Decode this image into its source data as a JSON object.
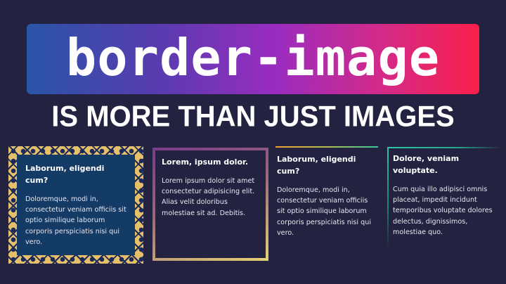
{
  "title": "border-image",
  "subtitle": "IS MORE THAN JUST IMAGES",
  "cards": [
    {
      "heading": "Laborum, eligendi cum?",
      "body": "Doloremque, modi in, consectetur veniam officiis sit optio similique laborum corporis perspiciatis nisi qui vero."
    },
    {
      "heading": "Lorem, ipsum dolor.",
      "body": "Lorem ipsum dolor sit amet consectetur adipisicing elit. Alias velit doloribus molestiae sit ad. Debitis."
    },
    {
      "heading": "Laborum, eligendi cum?",
      "body": "Doloremque, modi in, consectetur veniam officiis sit optio similique laborum corporis perspiciatis nisi qui vero."
    },
    {
      "heading": "Dolore, veniam voluptate.",
      "body": "Cum quia illo adipisci omnis placeat, impedit incidunt temporibus voluptate dolores delectus, dignissimos, molestiae quo."
    }
  ],
  "colors": {
    "background": "#232240",
    "banner_start": "#2a55a8",
    "banner_mid": "#9a2cc0",
    "banner_end": "#fa1f4a",
    "gold": "#e6c068",
    "teal": "#2ec6a8"
  }
}
